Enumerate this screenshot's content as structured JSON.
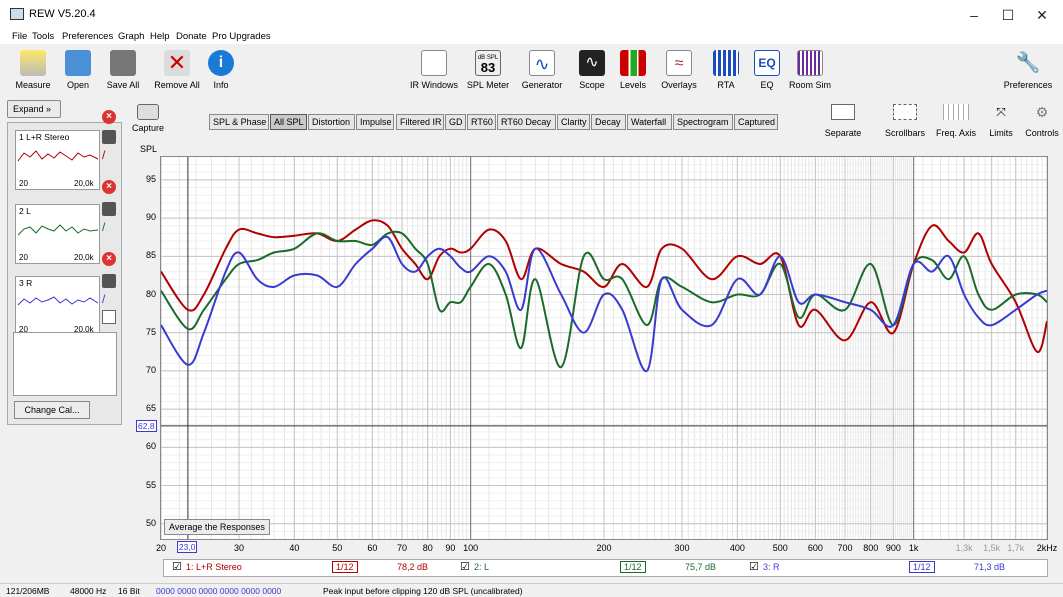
{
  "window": {
    "title": "REW V5.20.4",
    "min": "–",
    "max": "☐",
    "close": "✕"
  },
  "menu": [
    "File",
    "Tools",
    "Preferences",
    "Graph",
    "Help",
    "Donate",
    "Pro Upgrades"
  ],
  "toolbar_left": [
    {
      "label": "Measure",
      "icon": "measure-icon"
    },
    {
      "label": "Open",
      "icon": "folder-icon"
    },
    {
      "label": "Save All",
      "icon": "save-icon"
    },
    {
      "label": "Remove All",
      "icon": "remove-icon"
    },
    {
      "label": "Info",
      "icon": "info-icon"
    }
  ],
  "toolbar_mid": [
    {
      "label": "IR Windows",
      "icon": "ir-windows-icon"
    },
    {
      "label": "SPL Meter",
      "icon": "spl-meter-icon"
    },
    {
      "label": "Generator",
      "icon": "generator-icon"
    },
    {
      "label": "Scope",
      "icon": "scope-icon"
    },
    {
      "label": "Levels",
      "icon": "levels-icon"
    },
    {
      "label": "Overlays",
      "icon": "overlays-icon"
    },
    {
      "label": "RTA",
      "icon": "rta-icon"
    },
    {
      "label": "EQ",
      "icon": "eq-icon"
    },
    {
      "label": "Room Sim",
      "icon": "room-sim-icon"
    }
  ],
  "spl_badge_top": "dB SPL",
  "spl_badge_value": "83",
  "eq_badge": "EQ",
  "preferences": "Preferences",
  "expand": "Expand",
  "capture": "Capture",
  "tabs": [
    "SPL & Phase",
    "All SPL",
    "Distortion",
    "Impulse",
    "Filtered IR",
    "GD",
    "RT60",
    "RT60 Decay",
    "Clarity",
    "Decay",
    "Waterfall",
    "Spectrogram",
    "Captured"
  ],
  "selected_tab": "All SPL",
  "graph_controls": [
    "Separate",
    "Scrollbars",
    "Freq. Axis",
    "Limits",
    "Controls"
  ],
  "measurements": [
    {
      "label": "1 L+R Stereo",
      "lo": "20",
      "hi": "20,0k",
      "color": "#b00000"
    },
    {
      "label": "2 L",
      "lo": "20",
      "hi": "20,0k",
      "color": "#1a6b2a"
    },
    {
      "label": "3 R",
      "lo": "20",
      "hi": "20,0k",
      "color": "#3a3ad0"
    }
  ],
  "change_cal": "Change Cal...",
  "y_axis_label": "SPL",
  "y_ticks": [
    "95",
    "90",
    "85",
    "80",
    "75",
    "70",
    "65",
    "60",
    "55",
    "50"
  ],
  "y_cursor": "62,8",
  "x_ticks": [
    "20",
    "30",
    "40",
    "50",
    "60",
    "70",
    "80",
    "90",
    "100",
    "200",
    "300",
    "400",
    "500",
    "600",
    "700",
    "800",
    "900",
    "1k",
    "1,3k",
    "1,5k",
    "1,7k",
    "2kHz"
  ],
  "x_cursor": "23,0",
  "average_button": "Average the Responses",
  "legend": [
    {
      "check": "☑",
      "name": "1: L+R Stereo",
      "smoothing": "1/12",
      "value": "78,2 dB",
      "color": "#b00000"
    },
    {
      "check": "☑",
      "name": "2: L",
      "smoothing": "1/12",
      "value": "75,7 dB",
      "color": "#1a6b2a"
    },
    {
      "check": "☑",
      "name": "3: R",
      "smoothing": "1/12",
      "value": "71,3 dB",
      "color": "#3a3ad0"
    }
  ],
  "status": [
    "121/206MB",
    "48000 Hz",
    "16 Bit",
    "0000 0000  0000 0000  0000 0000",
    "Peak input before clipping 120 dB SPL (uncalibrated)"
  ],
  "chart_data": {
    "type": "line",
    "xscale": "log",
    "xlim": [
      20,
      2000
    ],
    "ylim": [
      48,
      98
    ],
    "ylabel": "SPL",
    "cursor": {
      "x": 23.0,
      "y": 62.8
    },
    "series": [
      {
        "name": "1: L+R Stereo",
        "color": "#b00000",
        "x": [
          20,
          23,
          25,
          28,
          30,
          33,
          36,
          40,
          45,
          50,
          55,
          60,
          65,
          70,
          75,
          80,
          85,
          90,
          95,
          100,
          110,
          120,
          130,
          140,
          160,
          180,
          200,
          220,
          250,
          270,
          300,
          350,
          400,
          450,
          500,
          550,
          600,
          700,
          800,
          900,
          1000,
          1100,
          1200,
          1300,
          1400,
          1500,
          1700,
          1900,
          2000
        ],
        "y": [
          83,
          78,
          80,
          86,
          88.5,
          88,
          87.5,
          87.7,
          88,
          87,
          88.5,
          89.7,
          89,
          86,
          84,
          82,
          85,
          86,
          85.5,
          86,
          88.5,
          87,
          82,
          86,
          84,
          83,
          81,
          84,
          81,
          86,
          86,
          82,
          85,
          84,
          85,
          76,
          78,
          74,
          79,
          75,
          84,
          89,
          87,
          85.5,
          88,
          84,
          79,
          72.5,
          76.5
        ]
      },
      {
        "name": "2: L",
        "color": "#1a6b2a",
        "x": [
          20,
          23,
          25,
          28,
          30,
          33,
          36,
          40,
          45,
          50,
          55,
          60,
          65,
          70,
          75,
          80,
          85,
          90,
          95,
          100,
          110,
          120,
          130,
          140,
          160,
          180,
          200,
          220,
          250,
          270,
          300,
          350,
          400,
          450,
          500,
          550,
          600,
          700,
          800,
          900,
          1000,
          1100,
          1200,
          1300,
          1400,
          1500,
          1700,
          1900,
          2000
        ],
        "y": [
          80.5,
          75.5,
          78,
          82,
          84,
          84.5,
          85.5,
          86,
          88,
          87,
          87,
          86.5,
          88,
          88,
          86,
          84,
          78,
          79,
          79,
          81,
          84,
          80,
          73,
          82,
          70.5,
          85,
          82,
          82,
          76,
          82,
          81,
          79,
          80,
          80,
          84,
          77,
          80,
          78,
          84,
          76,
          84,
          84.5,
          82,
          85,
          80,
          78,
          80,
          80,
          79
        ]
      },
      {
        "name": "3: R",
        "color": "#3a3ad0",
        "x": [
          20,
          23,
          25,
          28,
          30,
          33,
          36,
          40,
          45,
          50,
          55,
          60,
          65,
          70,
          75,
          80,
          85,
          90,
          95,
          100,
          110,
          120,
          130,
          140,
          160,
          180,
          200,
          220,
          250,
          270,
          300,
          350,
          400,
          450,
          500,
          550,
          600,
          700,
          800,
          900,
          1000,
          1100,
          1200,
          1300,
          1400,
          1500,
          1700,
          1900,
          2000
        ],
        "y": [
          76,
          70.8,
          75,
          83,
          85.5,
          82,
          81,
          82.5,
          82.5,
          81,
          84,
          86,
          87.5,
          84,
          83,
          85,
          86,
          85,
          83.5,
          83,
          85,
          83,
          78,
          86,
          80,
          75,
          80,
          78,
          70,
          82,
          78,
          76,
          82,
          80,
          85,
          79,
          80,
          79,
          78,
          76,
          84,
          83,
          85,
          80,
          77,
          76,
          78,
          80,
          80.5
        ]
      }
    ]
  }
}
